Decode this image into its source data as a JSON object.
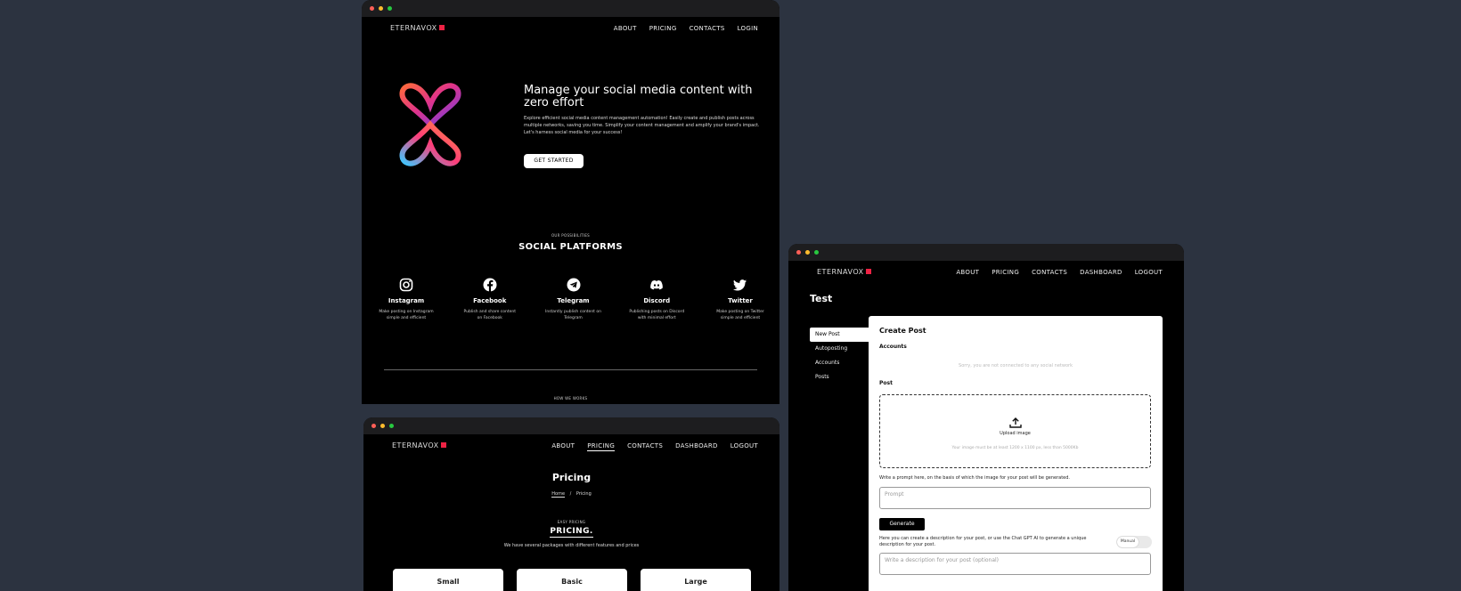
{
  "w1": {
    "logo": "ETERNAVOX",
    "nav": [
      "ABOUT",
      "PRICING",
      "CONTACTS",
      "LOGIN"
    ],
    "hero_title": "Manage your social media content with zero effort",
    "hero_text": "Explore efficient social media content management automation! Easily create and publish posts across multiple networks, saving you time. Simplify your content management and amplify your brand's impact. Let's harness social media for your success!",
    "cta": "GET STARTED",
    "possibilities_small": "OUR POSSIBILITIES",
    "possibilities_big": "SOCIAL PLATFORMS",
    "platforms": [
      {
        "name": "Instagram",
        "desc": "Make posting on Instagram simple and efficient",
        "icon": "instagram-icon"
      },
      {
        "name": "Facebook",
        "desc": "Publish and share content on Facebook",
        "icon": "facebook-icon"
      },
      {
        "name": "Telegram",
        "desc": "Instantly publish content on Telegram",
        "icon": "telegram-icon"
      },
      {
        "name": "Discord",
        "desc": "Publishing posts on Discord with minimal effort",
        "icon": "discord-icon"
      },
      {
        "name": "Twitter",
        "desc": "Make posting on Twitter simple and efficient",
        "icon": "twitter-icon"
      }
    ],
    "how_small": "HOW WE WORKS"
  },
  "w2": {
    "logo": "ETERNAVOX",
    "nav": [
      "ABOUT",
      "PRICING",
      "CONTACTS",
      "DASHBOARD",
      "LOGOUT"
    ],
    "title": "Pricing",
    "crumb_home": "Home",
    "crumb_sep": "/",
    "crumb_current": "Pricing",
    "small": "EASY PRICING",
    "big": "PRICING.",
    "desc": "We have several packages with different features and prices",
    "cards": [
      "Small",
      "Basic",
      "Large"
    ]
  },
  "w3": {
    "logo": "ETERNAVOX",
    "nav": [
      "ABOUT",
      "PRICING",
      "CONTACTS",
      "DASHBOARD",
      "LOGOUT"
    ],
    "title": "Test",
    "side": [
      "New Post",
      "Autoposting",
      "Accounts",
      "Posts"
    ],
    "panel_title": "Create Post",
    "accounts_label": "Accounts",
    "no_accounts": "Sorry, you are not connected to any social network",
    "post_label": "Post",
    "upload_label": "Upload image",
    "upload_hint": "Your image must be at least 1200 x 1100 px, less than 5000Kb",
    "prompt_text": "Write a prompt here, on the basis of which the image for your post will be generated.",
    "prompt_placeholder": "Prompt",
    "generate": "Generate",
    "desc_text": "Here you can create a description for your post, or use the Chat GPT AI to generate a unique description for your post.",
    "toggle_label": "Manual",
    "desc_placeholder": "Write a description for your post (optional)"
  }
}
